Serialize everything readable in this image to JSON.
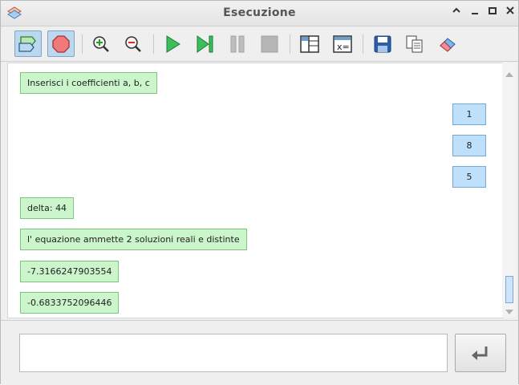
{
  "window": {
    "title": "Esecuzione",
    "controls": [
      "chevron-up-icon",
      "minimize-icon",
      "maximize-icon",
      "close-icon"
    ]
  },
  "toolbar": {
    "buttons": [
      {
        "icon": "flowchart-icon",
        "active": true
      },
      {
        "icon": "stop-sign-icon",
        "active": true
      },
      {
        "icon": "zoom-in-icon"
      },
      {
        "icon": "zoom-out-icon"
      },
      {
        "icon": "play-icon"
      },
      {
        "icon": "step-icon"
      },
      {
        "icon": "pause-icon"
      },
      {
        "icon": "stop-icon"
      },
      {
        "icon": "layout-icon"
      },
      {
        "icon": "variables-icon"
      },
      {
        "icon": "save-icon"
      },
      {
        "icon": "copy-icon"
      },
      {
        "icon": "eraser-icon"
      }
    ]
  },
  "conversation": {
    "messages": [
      {
        "direction": "output",
        "text": "Inserisci i coefficienti a, b, c"
      },
      {
        "direction": "input",
        "text": "1"
      },
      {
        "direction": "input",
        "text": "8"
      },
      {
        "direction": "input",
        "text": "5"
      },
      {
        "direction": "output",
        "text": "delta: 44"
      },
      {
        "direction": "output",
        "text": "l' equazione ammette 2 soluzioni reali e distinte"
      },
      {
        "direction": "output",
        "text": "-7.3166247903554"
      },
      {
        "direction": "output",
        "text": "-0.6833752096446"
      }
    ]
  },
  "input_bar": {
    "value": "",
    "placeholder": "",
    "send_icon": "enter-icon"
  },
  "colors": {
    "output_bubble": "#cbf5cb",
    "input_bubble": "#bfe0fb",
    "accent": "#76a9d6"
  }
}
